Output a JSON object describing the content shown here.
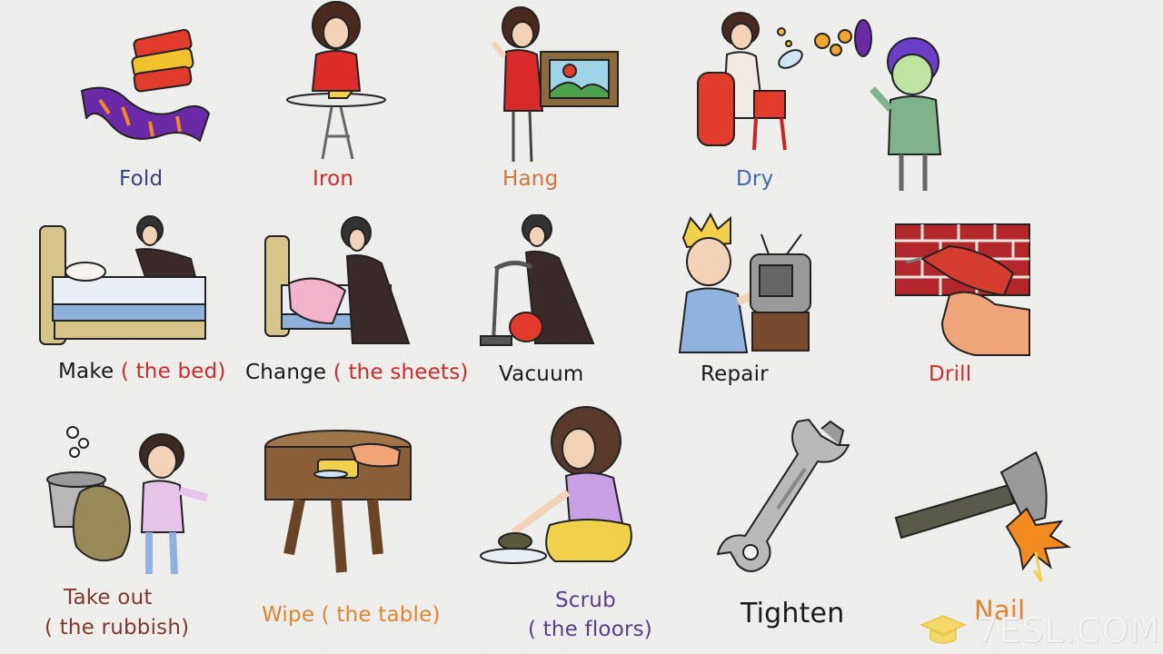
{
  "labels": {
    "fold": "Fold",
    "iron": "Iron",
    "hang": "Hang",
    "dry": "Dry",
    "make": "Make",
    "make_sub": "( the bed)",
    "change": "Change",
    "change_sub": "( the sheets)",
    "vacuum": "Vacuum",
    "repair": "Repair",
    "drill": "Drill",
    "takeout_line1": "Take out",
    "takeout_line2": "( the rubbish)",
    "wipe": "Wipe ( the table)",
    "scrub_line1": "Scrub",
    "scrub_line2": "( the floors)",
    "tighten": "Tighten",
    "nail": "Nail"
  },
  "watermark": {
    "text": "7ESL.COM",
    "icon": "graduation-cap-icon"
  },
  "colors": {
    "navy": "#3a3f7e",
    "red": "#d22b2b",
    "orange": "#d0763e",
    "blue": "#4466a7",
    "black": "#1a1a1a",
    "brown": "#7e3a2e",
    "amber": "#e0852f",
    "purple": "#5a3e86",
    "sub_red": "#cf2a2a"
  }
}
